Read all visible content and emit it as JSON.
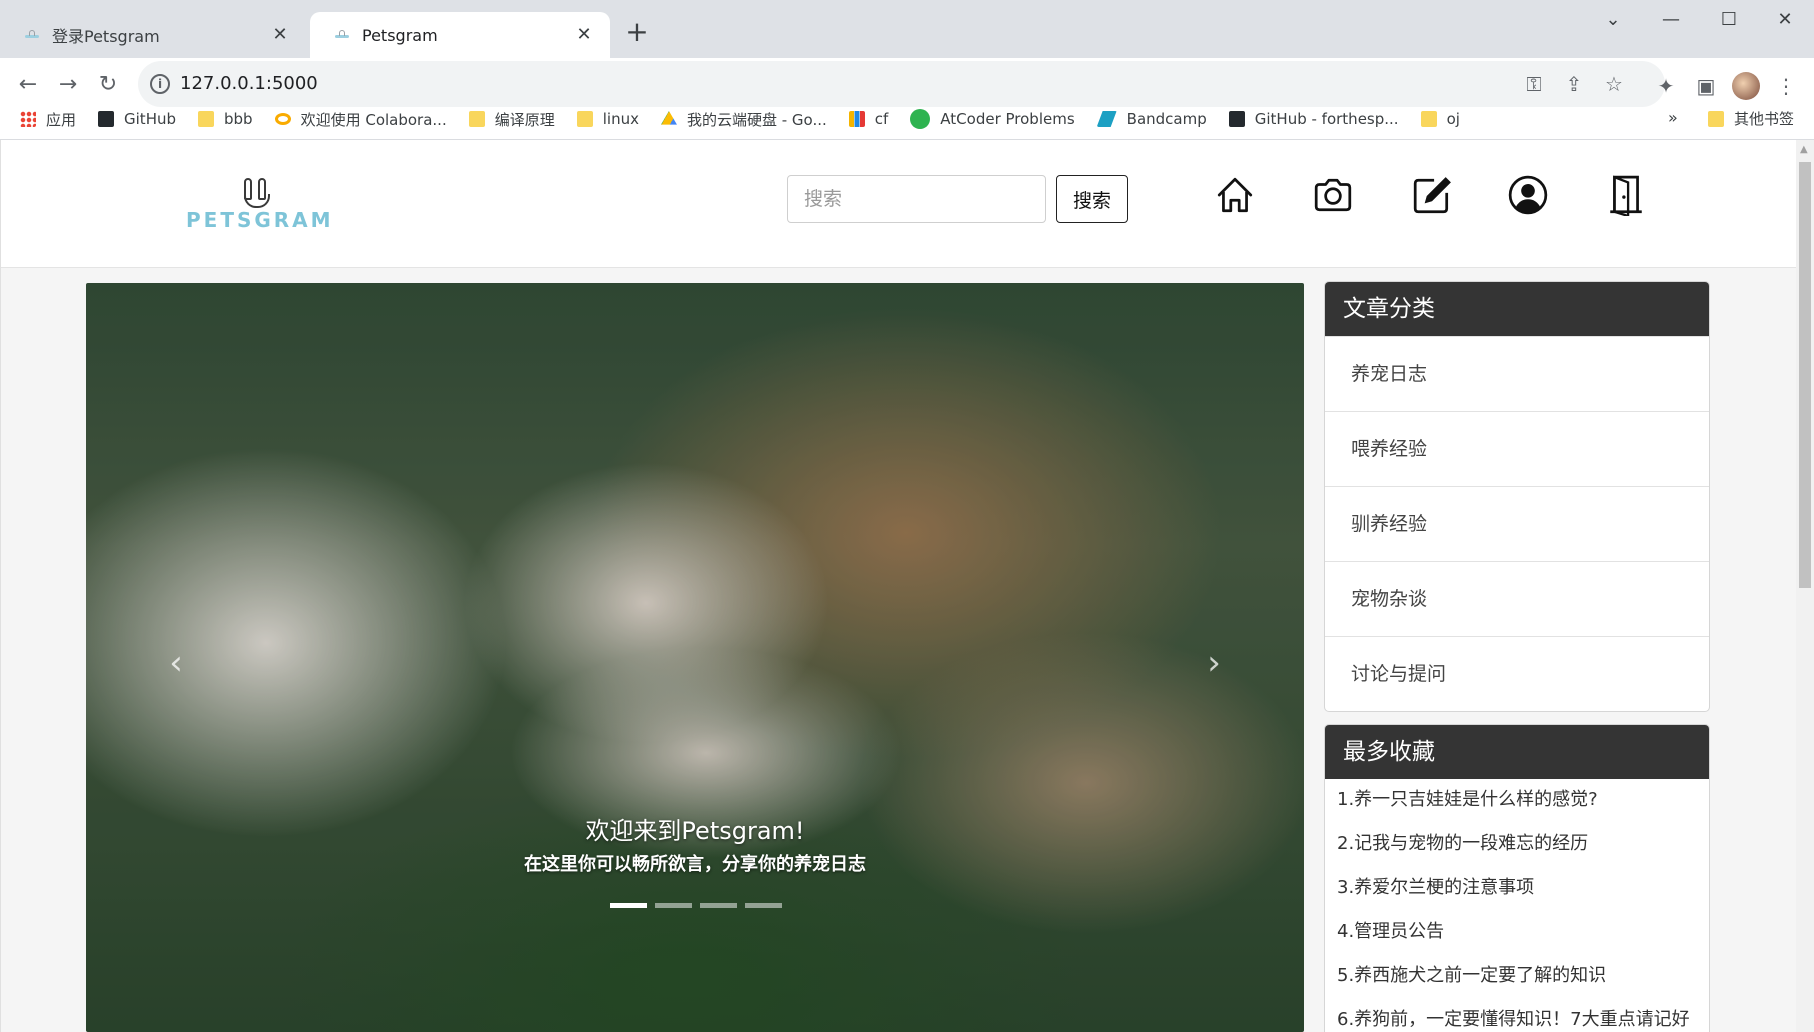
{
  "browser": {
    "tabs": [
      {
        "title": "登录Petsgram",
        "active": false
      },
      {
        "title": "Petsgram",
        "active": true
      }
    ],
    "url": "127.0.0.1:5000",
    "bookmarks": [
      {
        "label": "应用",
        "icon": "apps-grid-icon"
      },
      {
        "label": "GitHub",
        "icon": "github-icon"
      },
      {
        "label": "bbb",
        "icon": "folder-icon"
      },
      {
        "label": "欢迎使用 Colabora...",
        "icon": "colab-icon"
      },
      {
        "label": "编译原理",
        "icon": "folder-icon"
      },
      {
        "label": "linux",
        "icon": "folder-icon"
      },
      {
        "label": "我的云端硬盘 - Go...",
        "icon": "google-drive-icon"
      },
      {
        "label": "cf",
        "icon": "codeforces-icon"
      },
      {
        "label": "AtCoder Problems",
        "icon": "atcoder-icon"
      },
      {
        "label": "Bandcamp",
        "icon": "bandcamp-icon"
      },
      {
        "label": "GitHub - forthesp...",
        "icon": "github-icon"
      },
      {
        "label": "oj",
        "icon": "folder-icon"
      }
    ],
    "bookmarks_more": "»",
    "other_bookmarks": "其他书签"
  },
  "site": {
    "logo_text": "PETSGRAM",
    "search": {
      "placeholder": "搜索",
      "button": "搜索"
    },
    "nav_icons": [
      "home-icon",
      "camera-icon",
      "edit-icon",
      "user-icon",
      "logout-door-icon"
    ]
  },
  "carousel": {
    "title": "欢迎来到Petsgram!",
    "subtitle": "在这里你可以畅所欲言，分享你的养宠日志",
    "slide_count": 4,
    "active_slide": 1,
    "prev": "‹",
    "next": "›"
  },
  "categories": {
    "heading": "文章分类",
    "items": [
      "养宠日志",
      "喂养经验",
      "驯养经验",
      "宠物杂谈",
      "讨论与提问"
    ]
  },
  "favorites": {
    "heading": "最多收藏",
    "items": [
      "1.养一只吉娃娃是什么样的感觉?",
      "2.记我与宠物的一段难忘的经历",
      "3.养爱尔兰梗的注意事项",
      "4.管理员公告",
      "5.养西施犬之前一定要了解的知识",
      "6.养狗前，一定要懂得知识！7大重点请记好"
    ]
  }
}
